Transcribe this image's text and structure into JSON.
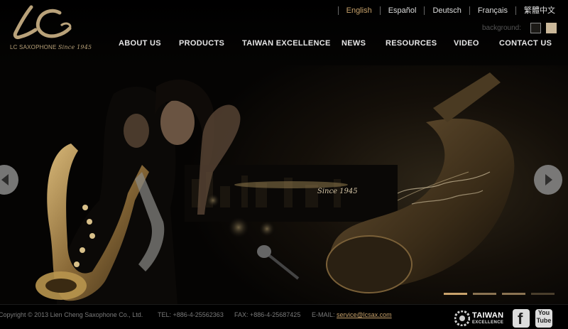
{
  "brand": {
    "logo_text": "LC SAXOPHONE",
    "logo_since": "Since 1945"
  },
  "languages": [
    {
      "label": "English"
    },
    {
      "label": "Español"
    },
    {
      "label": "Deutsch"
    },
    {
      "label": "Français"
    },
    {
      "label": "繁體中文"
    }
  ],
  "background_switch": {
    "label": "background:",
    "options": [
      "dark",
      "light"
    ]
  },
  "nav": [
    {
      "label": "ABOUT US"
    },
    {
      "label": "PRODUCTS"
    },
    {
      "label": "TAIWAN EXCELLENCE"
    },
    {
      "label": "NEWS"
    },
    {
      "label": "RESOURCES"
    },
    {
      "label": "VIDEO"
    },
    {
      "label": "CONTACT US"
    }
  ],
  "hero": {
    "since_text": "Since 1945",
    "slides_total": 4,
    "slide_active": 1
  },
  "footer": {
    "copyright": "Copyright © 2013 Lien Cheng Saxophone Co., Ltd.",
    "tel": "TEL: +886-4-25562363",
    "fax": "FAX: +886-4-25687425",
    "email_label": "E-MAIL:",
    "email": "service@lcsax.com",
    "taiwan_logo": "TAIWAN",
    "taiwan_logo_sub": "EXCELLENCE",
    "facebook_icon": "f",
    "youtube_icon": "You Tube"
  },
  "colors": {
    "accent": "#c8a26b",
    "background": "#000000"
  }
}
